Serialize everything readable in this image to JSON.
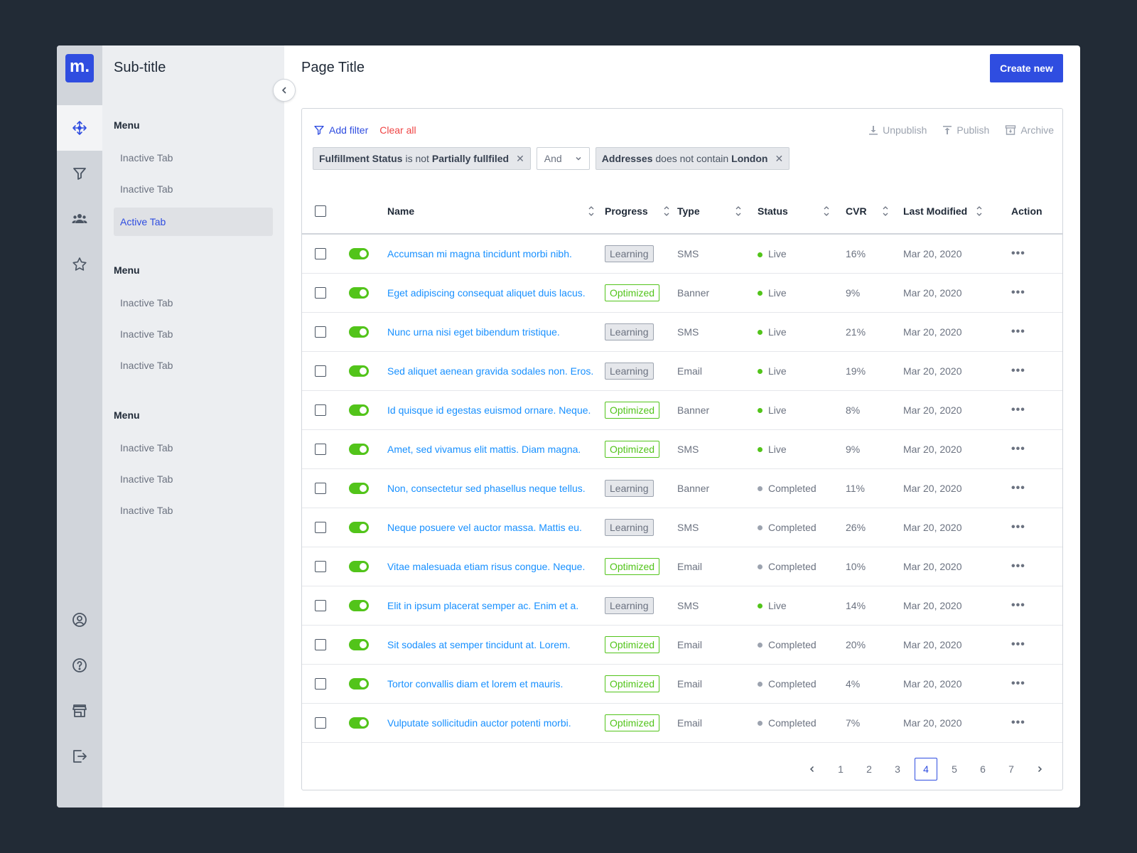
{
  "brand": {
    "logo_text": "m.",
    "accent": "#2f4de0"
  },
  "rail": {
    "top_icons": [
      "move-icon",
      "filter-icon",
      "users-icon",
      "star-icon"
    ],
    "bottom_icons": [
      "user-circle-icon",
      "help-icon",
      "store-icon",
      "logout-icon"
    ]
  },
  "sidebar": {
    "subtitle": "Sub-title",
    "groups": [
      {
        "heading": "Menu",
        "items": [
          "Inactive Tab",
          "Inactive Tab",
          "Active Tab"
        ],
        "active_index": 2
      },
      {
        "heading": "Menu",
        "items": [
          "Inactive Tab",
          "Inactive Tab",
          "Inactive Tab"
        ]
      },
      {
        "heading": "Menu",
        "items": [
          "Inactive Tab",
          "Inactive Tab",
          "Inactive Tab"
        ]
      }
    ]
  },
  "header": {
    "title": "Page Title",
    "create_label": "Create new"
  },
  "filters": {
    "add_filter_label": "Add filter",
    "clear_all_label": "Clear all",
    "bulk_actions": {
      "unpublish": "Unpublish",
      "publish": "Publish",
      "archive": "Archive"
    },
    "chip1": {
      "field": "Fulfillment Status",
      "op": "is not",
      "value": "Partially fullfiled"
    },
    "joiner": "And",
    "chip2": {
      "field": "Addresses",
      "op": "does not contain",
      "value": "London"
    }
  },
  "table": {
    "columns": {
      "name": "Name",
      "progress": "Progress",
      "type": "Type",
      "status": "Status",
      "cvr": "CVR",
      "modified": "Last Modified",
      "action": "Action"
    },
    "status_colors": {
      "Live": "#52c41a",
      "Completed": "#9ca3af"
    },
    "rows": [
      {
        "name": "Accumsan mi magna tincidunt morbi nibh.",
        "progress": "Learning",
        "type": "SMS",
        "status": "Live",
        "cvr": "16%",
        "modified": "Mar 20, 2020",
        "enabled": true
      },
      {
        "name": "Eget adipiscing consequat aliquet duis lacus.",
        "progress": "Optimized",
        "type": "Banner",
        "status": "Live",
        "cvr": "9%",
        "modified": "Mar 20, 2020",
        "enabled": true
      },
      {
        "name": "Nunc urna nisi eget bibendum tristique.",
        "progress": "Learning",
        "type": "SMS",
        "status": "Live",
        "cvr": "21%",
        "modified": "Mar 20, 2020",
        "enabled": true
      },
      {
        "name": "Sed aliquet aenean gravida sodales non. Eros.",
        "progress": "Learning",
        "type": "Email",
        "status": "Live",
        "cvr": "19%",
        "modified": "Mar 20, 2020",
        "enabled": true
      },
      {
        "name": "Id quisque id egestas euismod ornare. Neque.",
        "progress": "Optimized",
        "type": "Banner",
        "status": "Live",
        "cvr": "8%",
        "modified": "Mar 20, 2020",
        "enabled": true
      },
      {
        "name": "Amet, sed vivamus elit mattis. Diam magna.",
        "progress": "Optimized",
        "type": "SMS",
        "status": "Live",
        "cvr": "9%",
        "modified": "Mar 20, 2020",
        "enabled": true
      },
      {
        "name": "Non, consectetur sed phasellus neque tellus.",
        "progress": "Learning",
        "type": "Banner",
        "status": "Completed",
        "cvr": "11%",
        "modified": "Mar 20, 2020",
        "enabled": true
      },
      {
        "name": "Neque posuere vel auctor massa. Mattis eu.",
        "progress": "Learning",
        "type": "SMS",
        "status": "Completed",
        "cvr": "26%",
        "modified": "Mar 20, 2020",
        "enabled": true
      },
      {
        "name": "Vitae malesuada etiam risus congue. Neque.",
        "progress": "Optimized",
        "type": "Email",
        "status": "Completed",
        "cvr": "10%",
        "modified": "Mar 20, 2020",
        "enabled": true
      },
      {
        "name": "Elit in ipsum placerat semper ac. Enim et a.",
        "progress": "Learning",
        "type": "SMS",
        "status": "Live",
        "cvr": "14%",
        "modified": "Mar 20, 2020",
        "enabled": true
      },
      {
        "name": "Sit sodales at semper tincidunt at. Lorem.",
        "progress": "Optimized",
        "type": "Email",
        "status": "Completed",
        "cvr": "20%",
        "modified": "Mar 20, 2020",
        "enabled": true
      },
      {
        "name": "Tortor convallis diam et lorem et mauris.",
        "progress": "Optimized",
        "type": "Email",
        "status": "Completed",
        "cvr": "4%",
        "modified": "Mar 20, 2020",
        "enabled": true
      },
      {
        "name": "Vulputate sollicitudin auctor potenti morbi.",
        "progress": "Optimized",
        "type": "Email",
        "status": "Completed",
        "cvr": "7%",
        "modified": "Mar 20, 2020",
        "enabled": true
      }
    ]
  },
  "pagination": {
    "pages": [
      "1",
      "2",
      "3",
      "4",
      "5",
      "6",
      "7"
    ],
    "current": "4"
  }
}
